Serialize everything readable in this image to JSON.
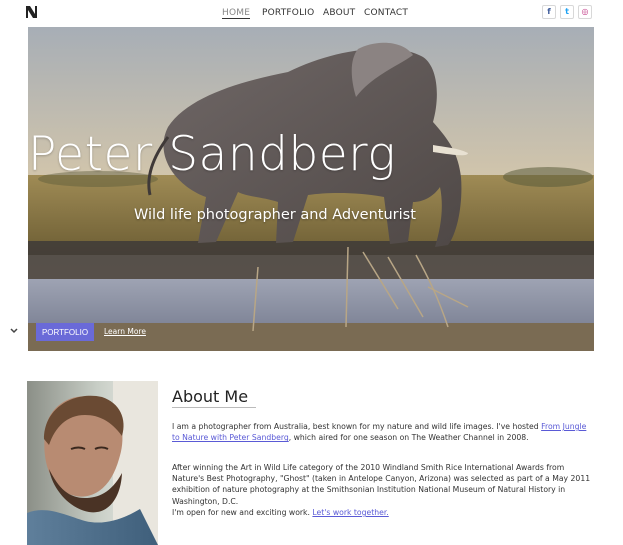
{
  "header": {
    "logo_icon": "n-logo-icon",
    "nav": [
      {
        "label": "HOME"
      },
      {
        "label": "PORTFOLIO"
      },
      {
        "label": "ABOUT"
      },
      {
        "label": "CONTACT"
      }
    ],
    "social": [
      {
        "icon": "facebook-icon",
        "glyph": "f"
      },
      {
        "icon": "twitter-icon",
        "glyph": "t"
      },
      {
        "icon": "instagram-icon",
        "glyph": "◎"
      }
    ]
  },
  "hero": {
    "title": "Peter Sandberg",
    "subtitle": "Wild life photographer and Adventurist",
    "primary_button": "PORTFOLIO",
    "secondary_link": "Learn More",
    "scroll_icon": "chevron-down-icon"
  },
  "about": {
    "title": "About Me",
    "p1_a": "I am a photographer from Australia, best known for my nature and wild life images. I've hosted ",
    "p1_link": "From Jungle to Nature with Peter Sandberg",
    "p1_b": ", which aired for one season on The Weather Channel in 2008.",
    "p2": "After winning the Art in Wild Life category of the 2010 Windland Smith Rice International Awards from Nature's Best Photography, \"Ghost\" (taken in Antelope Canyon, Arizona) was selected as part of a May 2011 exhibition of nature photography at the Smithsonian Institution National Museum of Natural History in Washington, D.C.",
    "p3_a": "I'm open for new and exciting work. ",
    "p3_link": "Let's work together."
  },
  "colors": {
    "accent": "#6a6ad8",
    "link": "#5a5ad6"
  }
}
